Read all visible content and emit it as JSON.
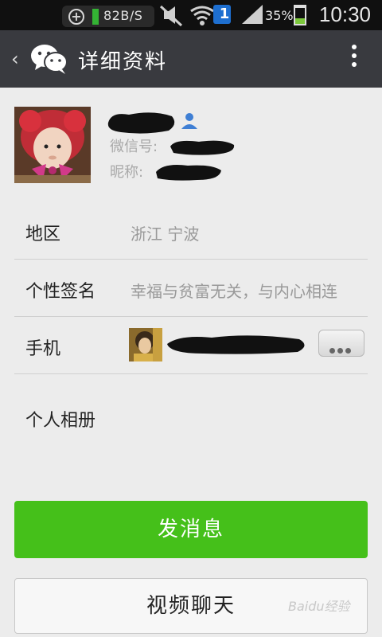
{
  "status_bar": {
    "net_speed": "82B/S",
    "battery": "35%",
    "time": "10:30",
    "sim_badge": "1"
  },
  "header": {
    "title": "详细资料"
  },
  "profile": {
    "wechat_id_label": "微信号:",
    "nickname_label": "昵称:"
  },
  "rows": [
    {
      "label": "地区",
      "value": "浙江  宁波"
    },
    {
      "label": "个性签名",
      "value": "幸福与贫富无关，与内心相连"
    },
    {
      "label": "手机",
      "value": ""
    }
  ],
  "album": {
    "label": "个人相册"
  },
  "buttons": {
    "send_message": "发消息",
    "video_chat": "视频聊天"
  },
  "watermark": "Baidu经验",
  "colors": {
    "titlebar": "#393a3f",
    "primary_green": "#45c01a",
    "background": "#ececec"
  }
}
